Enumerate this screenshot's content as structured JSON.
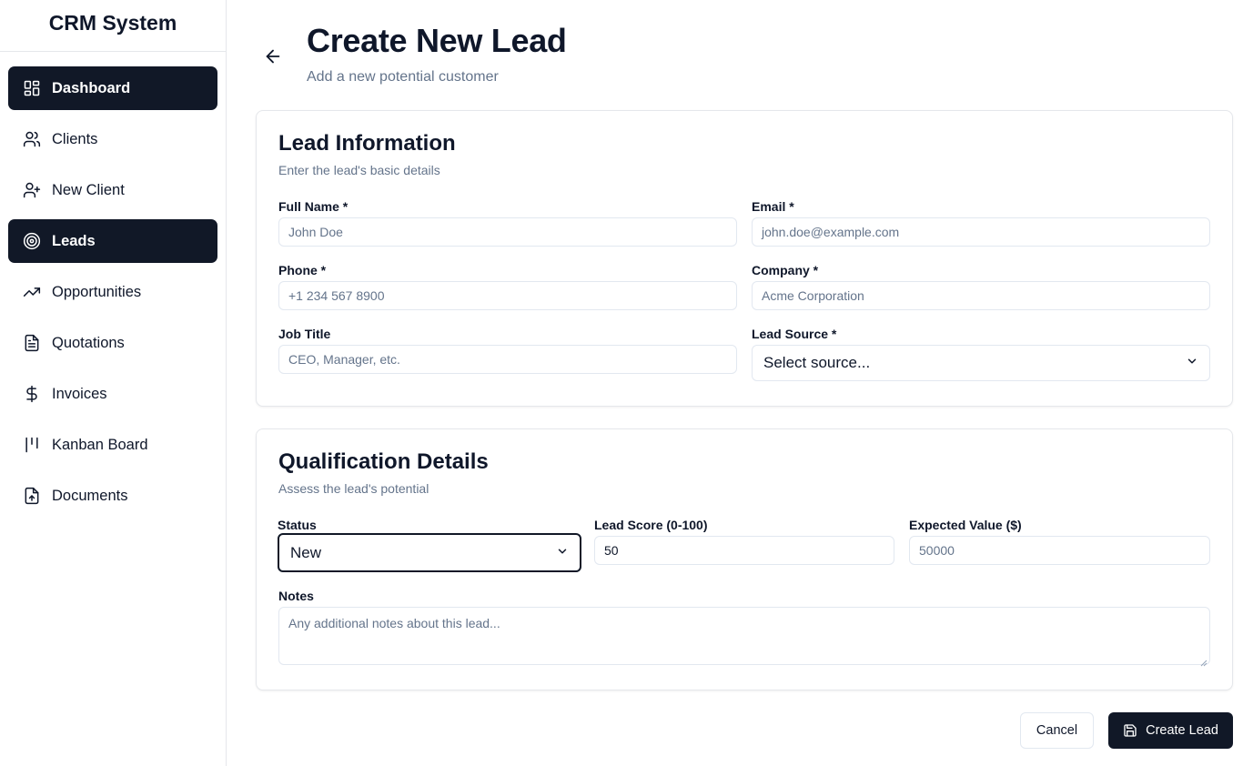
{
  "app": {
    "brand": "CRM System"
  },
  "sidebar": {
    "items": [
      {
        "label": "Dashboard",
        "icon": "dashboard-icon",
        "active": true
      },
      {
        "label": "Clients",
        "icon": "users-icon",
        "active": false
      },
      {
        "label": "New Client",
        "icon": "user-plus-icon",
        "active": false
      },
      {
        "label": "Leads",
        "icon": "target-icon",
        "active": true
      },
      {
        "label": "Opportunities",
        "icon": "trending-up-icon",
        "active": false
      },
      {
        "label": "Quotations",
        "icon": "file-text-icon",
        "active": false
      },
      {
        "label": "Invoices",
        "icon": "dollar-icon",
        "active": false
      },
      {
        "label": "Kanban Board",
        "icon": "kanban-icon",
        "active": false
      },
      {
        "label": "Documents",
        "icon": "file-upload-icon",
        "active": false
      }
    ]
  },
  "header": {
    "title": "Create New Lead",
    "subtitle": "Add a new potential customer",
    "back_icon": "arrow-left-icon"
  },
  "lead_info": {
    "title": "Lead Information",
    "subtitle": "Enter the lead's basic details",
    "full_name": {
      "label": "Full Name *",
      "placeholder": "John Doe",
      "value": ""
    },
    "email": {
      "label": "Email *",
      "placeholder": "john.doe@example.com",
      "value": ""
    },
    "phone": {
      "label": "Phone *",
      "placeholder": "+1 234 567 8900",
      "value": ""
    },
    "company": {
      "label": "Company *",
      "placeholder": "Acme Corporation",
      "value": ""
    },
    "job_title": {
      "label": "Job Title",
      "placeholder": "CEO, Manager, etc.",
      "value": ""
    },
    "lead_source": {
      "label": "Lead Source *",
      "selected": "Select source..."
    }
  },
  "qualification": {
    "title": "Qualification Details",
    "subtitle": "Assess the lead's potential",
    "status": {
      "label": "Status",
      "selected": "New"
    },
    "lead_score": {
      "label": "Lead Score (0-100)",
      "value": "50"
    },
    "expected_value": {
      "label": "Expected Value ($)",
      "placeholder": "50000",
      "value": ""
    },
    "notes": {
      "label": "Notes",
      "placeholder": "Any additional notes about this lead...",
      "value": ""
    }
  },
  "actions": {
    "cancel_label": "Cancel",
    "create_label": "Create Lead",
    "create_icon": "save-icon"
  },
  "colors": {
    "primary": "#111827",
    "muted_text": "#64748b",
    "border": "#e2e8f0"
  }
}
